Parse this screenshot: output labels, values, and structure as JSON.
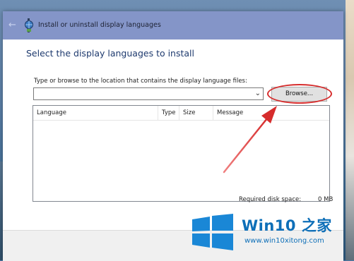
{
  "window": {
    "title": "Install or uninstall display languages",
    "back_glyph": "←"
  },
  "page": {
    "heading": "Select the display languages to install",
    "instruction": "Type or browse to the location that contains the display language files:",
    "path_value": "",
    "browse_label": "Browse..."
  },
  "list": {
    "columns": [
      "Language",
      "Type",
      "Size",
      "Message"
    ]
  },
  "disk": {
    "label": "Required disk space:",
    "value": "0 MB"
  },
  "watermark": {
    "title": "Win10 之家",
    "url": "www.win10xitong.com"
  },
  "colors": {
    "titlebar": "#8495c8",
    "heading": "#1e3a6e",
    "annotation_red": "#d62c2c",
    "watermark_blue": "#0e6fb8"
  }
}
